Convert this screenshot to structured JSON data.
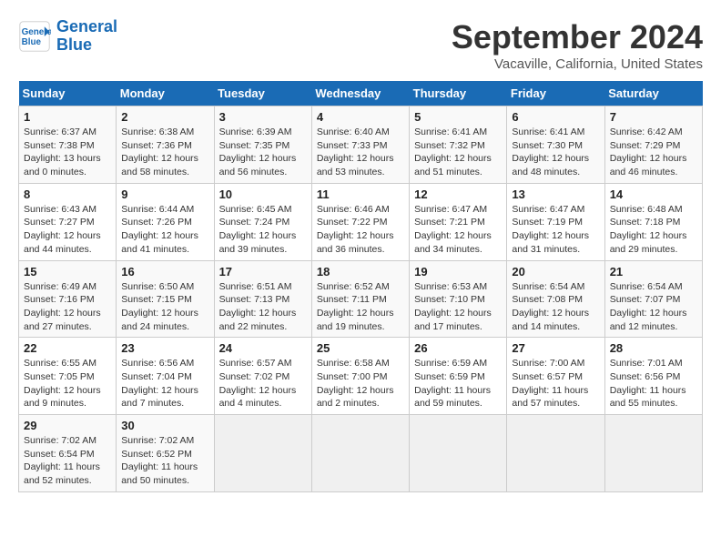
{
  "header": {
    "logo_line1": "General",
    "logo_line2": "Blue",
    "title": "September 2024",
    "subtitle": "Vacaville, California, United States"
  },
  "columns": [
    "Sunday",
    "Monday",
    "Tuesday",
    "Wednesday",
    "Thursday",
    "Friday",
    "Saturday"
  ],
  "weeks": [
    [
      {
        "day": "1",
        "info": "Sunrise: 6:37 AM\nSunset: 7:38 PM\nDaylight: 13 hours\nand 0 minutes."
      },
      {
        "day": "2",
        "info": "Sunrise: 6:38 AM\nSunset: 7:36 PM\nDaylight: 12 hours\nand 58 minutes."
      },
      {
        "day": "3",
        "info": "Sunrise: 6:39 AM\nSunset: 7:35 PM\nDaylight: 12 hours\nand 56 minutes."
      },
      {
        "day": "4",
        "info": "Sunrise: 6:40 AM\nSunset: 7:33 PM\nDaylight: 12 hours\nand 53 minutes."
      },
      {
        "day": "5",
        "info": "Sunrise: 6:41 AM\nSunset: 7:32 PM\nDaylight: 12 hours\nand 51 minutes."
      },
      {
        "day": "6",
        "info": "Sunrise: 6:41 AM\nSunset: 7:30 PM\nDaylight: 12 hours\nand 48 minutes."
      },
      {
        "day": "7",
        "info": "Sunrise: 6:42 AM\nSunset: 7:29 PM\nDaylight: 12 hours\nand 46 minutes."
      }
    ],
    [
      {
        "day": "8",
        "info": "Sunrise: 6:43 AM\nSunset: 7:27 PM\nDaylight: 12 hours\nand 44 minutes."
      },
      {
        "day": "9",
        "info": "Sunrise: 6:44 AM\nSunset: 7:26 PM\nDaylight: 12 hours\nand 41 minutes."
      },
      {
        "day": "10",
        "info": "Sunrise: 6:45 AM\nSunset: 7:24 PM\nDaylight: 12 hours\nand 39 minutes."
      },
      {
        "day": "11",
        "info": "Sunrise: 6:46 AM\nSunset: 7:22 PM\nDaylight: 12 hours\nand 36 minutes."
      },
      {
        "day": "12",
        "info": "Sunrise: 6:47 AM\nSunset: 7:21 PM\nDaylight: 12 hours\nand 34 minutes."
      },
      {
        "day": "13",
        "info": "Sunrise: 6:47 AM\nSunset: 7:19 PM\nDaylight: 12 hours\nand 31 minutes."
      },
      {
        "day": "14",
        "info": "Sunrise: 6:48 AM\nSunset: 7:18 PM\nDaylight: 12 hours\nand 29 minutes."
      }
    ],
    [
      {
        "day": "15",
        "info": "Sunrise: 6:49 AM\nSunset: 7:16 PM\nDaylight: 12 hours\nand 27 minutes."
      },
      {
        "day": "16",
        "info": "Sunrise: 6:50 AM\nSunset: 7:15 PM\nDaylight: 12 hours\nand 24 minutes."
      },
      {
        "day": "17",
        "info": "Sunrise: 6:51 AM\nSunset: 7:13 PM\nDaylight: 12 hours\nand 22 minutes."
      },
      {
        "day": "18",
        "info": "Sunrise: 6:52 AM\nSunset: 7:11 PM\nDaylight: 12 hours\nand 19 minutes."
      },
      {
        "day": "19",
        "info": "Sunrise: 6:53 AM\nSunset: 7:10 PM\nDaylight: 12 hours\nand 17 minutes."
      },
      {
        "day": "20",
        "info": "Sunrise: 6:54 AM\nSunset: 7:08 PM\nDaylight: 12 hours\nand 14 minutes."
      },
      {
        "day": "21",
        "info": "Sunrise: 6:54 AM\nSunset: 7:07 PM\nDaylight: 12 hours\nand 12 minutes."
      }
    ],
    [
      {
        "day": "22",
        "info": "Sunrise: 6:55 AM\nSunset: 7:05 PM\nDaylight: 12 hours\nand 9 minutes."
      },
      {
        "day": "23",
        "info": "Sunrise: 6:56 AM\nSunset: 7:04 PM\nDaylight: 12 hours\nand 7 minutes."
      },
      {
        "day": "24",
        "info": "Sunrise: 6:57 AM\nSunset: 7:02 PM\nDaylight: 12 hours\nand 4 minutes."
      },
      {
        "day": "25",
        "info": "Sunrise: 6:58 AM\nSunset: 7:00 PM\nDaylight: 12 hours\nand 2 minutes."
      },
      {
        "day": "26",
        "info": "Sunrise: 6:59 AM\nSunset: 6:59 PM\nDaylight: 11 hours\nand 59 minutes."
      },
      {
        "day": "27",
        "info": "Sunrise: 7:00 AM\nSunset: 6:57 PM\nDaylight: 11 hours\nand 57 minutes."
      },
      {
        "day": "28",
        "info": "Sunrise: 7:01 AM\nSunset: 6:56 PM\nDaylight: 11 hours\nand 55 minutes."
      }
    ],
    [
      {
        "day": "29",
        "info": "Sunrise: 7:02 AM\nSunset: 6:54 PM\nDaylight: 11 hours\nand 52 minutes."
      },
      {
        "day": "30",
        "info": "Sunrise: 7:02 AM\nSunset: 6:52 PM\nDaylight: 11 hours\nand 50 minutes."
      },
      {
        "day": "",
        "info": ""
      },
      {
        "day": "",
        "info": ""
      },
      {
        "day": "",
        "info": ""
      },
      {
        "day": "",
        "info": ""
      },
      {
        "day": "",
        "info": ""
      }
    ]
  ]
}
